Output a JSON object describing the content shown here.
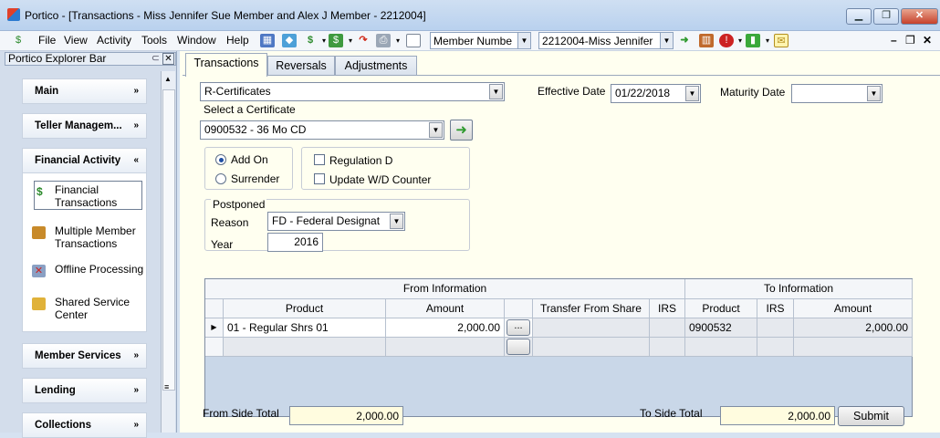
{
  "window": {
    "title": "Portico - [Transactions - Miss Jennifer Sue Member and Alex J Member - 2212004]",
    "minimize": "▁",
    "restore": "❐",
    "close": "✕"
  },
  "menu": {
    "items": [
      "File",
      "View",
      "Activity",
      "Tools",
      "Window",
      "Help"
    ],
    "member_search_type": "Member Numbe",
    "member_selected": "2212004-Miss Jennifer",
    "mdi_min": "–",
    "mdi_restore": "❐",
    "mdi_close": "✕"
  },
  "explorer": {
    "title": "Portico Explorer Bar",
    "groups": {
      "main": "Main",
      "teller": "Teller Managem...",
      "financial": "Financial Activity",
      "member_services": "Member Services",
      "lending": "Lending",
      "collections": "Collections"
    },
    "financial_items": [
      {
        "label": "Financial Transactions"
      },
      {
        "label": "Multiple Member Transactions"
      },
      {
        "label": "Offline Processing"
      },
      {
        "label": "Shared Service Center"
      }
    ]
  },
  "tabs": [
    "Transactions",
    "Reversals",
    "Adjustments"
  ],
  "form": {
    "transaction_type": "R-Certificates",
    "select_certificate_label": "Select a Certificate",
    "certificate": "0900532 - 36 Mo CD",
    "effective_date_label": "Effective Date",
    "effective_date": "01/22/2018",
    "maturity_date_label": "Maturity Date",
    "maturity_date": "",
    "add_on": "Add On",
    "surrender": "Surrender",
    "regulation_d": "Regulation D",
    "update_wd_counter": "Update W/D Counter",
    "postponed_label": "Postponed",
    "reason_label": "Reason",
    "reason": "FD - Federal Designat",
    "year_label": "Year",
    "year": "2016"
  },
  "grid": {
    "from_header": "From Information",
    "to_header": "To Information",
    "columns": {
      "product": "Product",
      "amount": "Amount",
      "transfer_from_share": "Transfer From Share",
      "irs": "IRS",
      "to_product": "Product",
      "to_irs": "IRS",
      "to_amount": "Amount"
    },
    "rows": [
      {
        "product": "01 - Regular Shrs 01",
        "amount": "2,000.00",
        "ellipsis": "...",
        "transfer_from_share": "",
        "irs": "",
        "to_product": "0900532",
        "to_irs": "",
        "to_amount": "2,000.00"
      }
    ]
  },
  "totals": {
    "from_label": "From Side Total",
    "from_value": "2,000.00",
    "to_label": "To Side Total",
    "to_value": "2,000.00",
    "submit": "Submit"
  },
  "colors": {
    "accent": "#1f4ea3",
    "panel_bg": "#fffff0",
    "grid_bg": "#c9d7e8",
    "explorer_bg": "#d3ddeb"
  }
}
